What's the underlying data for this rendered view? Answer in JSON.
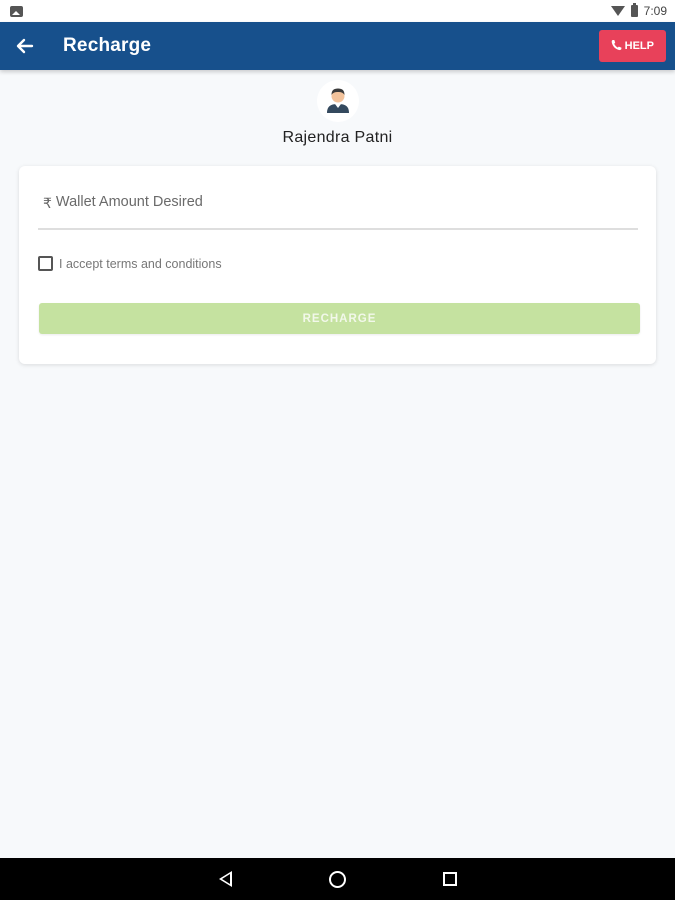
{
  "status_bar": {
    "time": "7:09",
    "icons": [
      "gallery-icon",
      "wifi-icon",
      "battery-icon"
    ]
  },
  "app_bar": {
    "title": "Recharge",
    "back_icon": "arrow-left-icon",
    "help_label": "HELP",
    "help_icon": "phone-icon",
    "background_color": "#17508c",
    "help_color": "#e8415a"
  },
  "profile": {
    "name": "Rajendra Patni",
    "avatar_icon": "user-avatar-icon"
  },
  "form": {
    "currency_symbol": "₹",
    "amount_placeholder": "Wallet Amount Desired",
    "amount_value": "",
    "terms_label": "I accept terms and conditions",
    "terms_checked": false,
    "recharge_label": "RECHARGE",
    "recharge_color": "#c5e2a0"
  },
  "nav_bar": {
    "icons": [
      "nav-back-icon",
      "nav-home-icon",
      "nav-recents-icon"
    ]
  }
}
